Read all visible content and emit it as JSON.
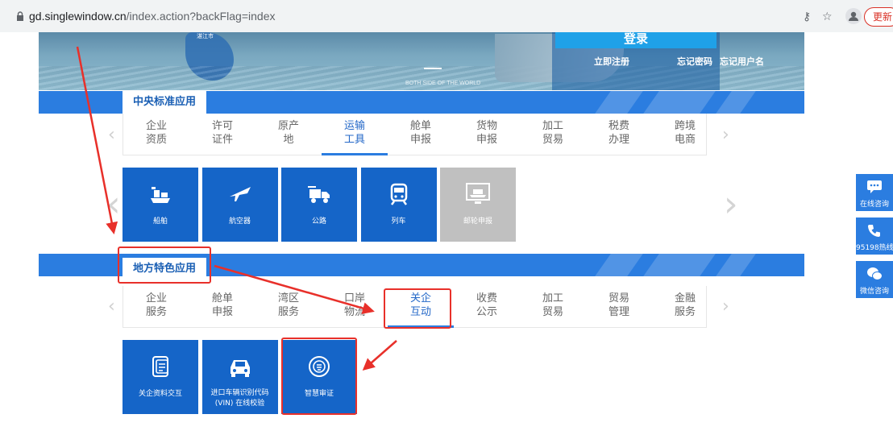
{
  "browser": {
    "url_host": "gd.singlewindow.cn",
    "url_path": "/index.action?backFlag=index",
    "update_label": "更新"
  },
  "hero": {
    "city_label": "湛江市",
    "caption": "BOTH SIDE OF THE WORLD",
    "login_label": "登录",
    "register_label": "立即注册",
    "forgot_password_label": "忘记密码",
    "forgot_username_label": "忘记用户名"
  },
  "central": {
    "title": "中央标准应用",
    "tabs": [
      {
        "l1": "企业",
        "l2": "资质"
      },
      {
        "l1": "许可",
        "l2": "证件"
      },
      {
        "l1": "原产",
        "l2": "地"
      },
      {
        "l1": "运输",
        "l2": "工具"
      },
      {
        "l1": "舱单",
        "l2": "申报"
      },
      {
        "l1": "货物",
        "l2": "申报"
      },
      {
        "l1": "加工",
        "l2": "贸易"
      },
      {
        "l1": "税费",
        "l2": "办理"
      },
      {
        "l1": "跨境",
        "l2": "电商"
      }
    ],
    "active_tab": 3,
    "tiles": [
      {
        "label": "船舶",
        "icon": "ship-icon"
      },
      {
        "label": "航空器",
        "icon": "airplane-icon"
      },
      {
        "label": "公路",
        "icon": "truck-icon"
      },
      {
        "label": "列车",
        "icon": "train-icon"
      },
      {
        "label": "邮轮申报",
        "icon": "cruise-ship-icon"
      }
    ]
  },
  "local": {
    "title": "地方特色应用",
    "tabs": [
      {
        "l1": "企业",
        "l2": "服务"
      },
      {
        "l1": "舱单",
        "l2": "申报"
      },
      {
        "l1": "湾区",
        "l2": "服务"
      },
      {
        "l1": "口岸",
        "l2": "物流"
      },
      {
        "l1": "关企",
        "l2": "互动"
      },
      {
        "l1": "收费",
        "l2": "公示"
      },
      {
        "l1": "加工",
        "l2": "贸易"
      },
      {
        "l1": "贸易",
        "l2": "管理"
      },
      {
        "l1": "金融",
        "l2": "服务"
      }
    ],
    "active_tab": 4,
    "tiles": [
      {
        "label": "关企资料交互",
        "label2": "",
        "icon": "document-icon"
      },
      {
        "label": "进口车辆识别代码",
        "label2": "(VIN) 在线校验",
        "icon": "car-icon"
      },
      {
        "label": "智慧审证",
        "label2": "",
        "icon": "certificate-seal-icon"
      }
    ]
  },
  "side_tools": [
    {
      "label": "在线咨询",
      "icon": "chat-bubble-icon"
    },
    {
      "label": "95198热线",
      "icon": "phone-icon"
    },
    {
      "label": "微信咨询",
      "icon": "wechat-icon"
    }
  ],
  "colors": {
    "primary_blue": "#2b7de0",
    "tile_blue": "#1565c8",
    "annotation_red": "#e8302a"
  }
}
